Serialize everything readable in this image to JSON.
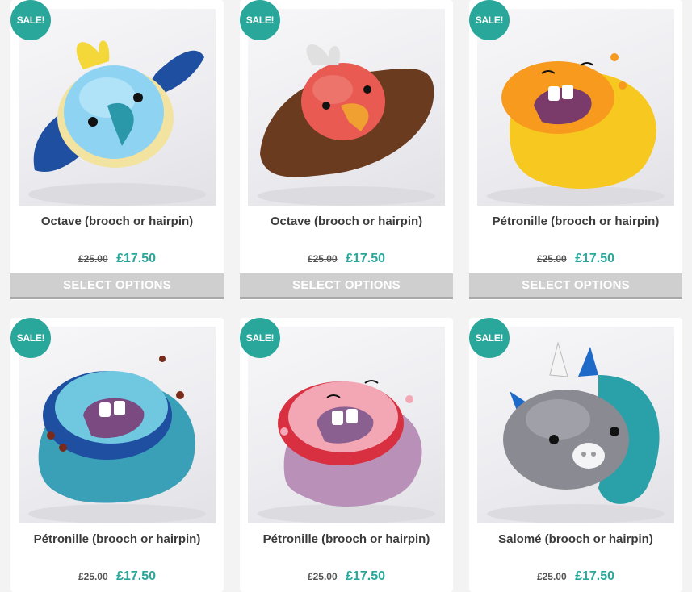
{
  "products": [
    {
      "badge": "SALE!",
      "title": "Octave (brooch or hairpin)",
      "old_price": "£25.00",
      "price": "£17.50",
      "button": "SELECT OPTIONS"
    },
    {
      "badge": "SALE!",
      "title": "Octave (brooch or hairpin)",
      "old_price": "£25.00",
      "price": "£17.50",
      "button": "SELECT OPTIONS"
    },
    {
      "badge": "SALE!",
      "title": "Pétronille (brooch or hairpin)",
      "old_price": "£25.00",
      "price": "£17.50",
      "button": "SELECT OPTIONS"
    },
    {
      "badge": "SALE!",
      "title": "Pétronille (brooch or hairpin)",
      "old_price": "£25.00",
      "price": "£17.50"
    },
    {
      "badge": "SALE!",
      "title": "Pétronille (brooch or hairpin)",
      "old_price": "£25.00",
      "price": "£17.50"
    },
    {
      "badge": "SALE!",
      "title": "Salomé (brooch or hairpin)",
      "old_price": "£25.00",
      "price": "£17.50"
    }
  ],
  "colors": {
    "accent": "#2aa79b",
    "button_bg": "#cfcfcf"
  }
}
